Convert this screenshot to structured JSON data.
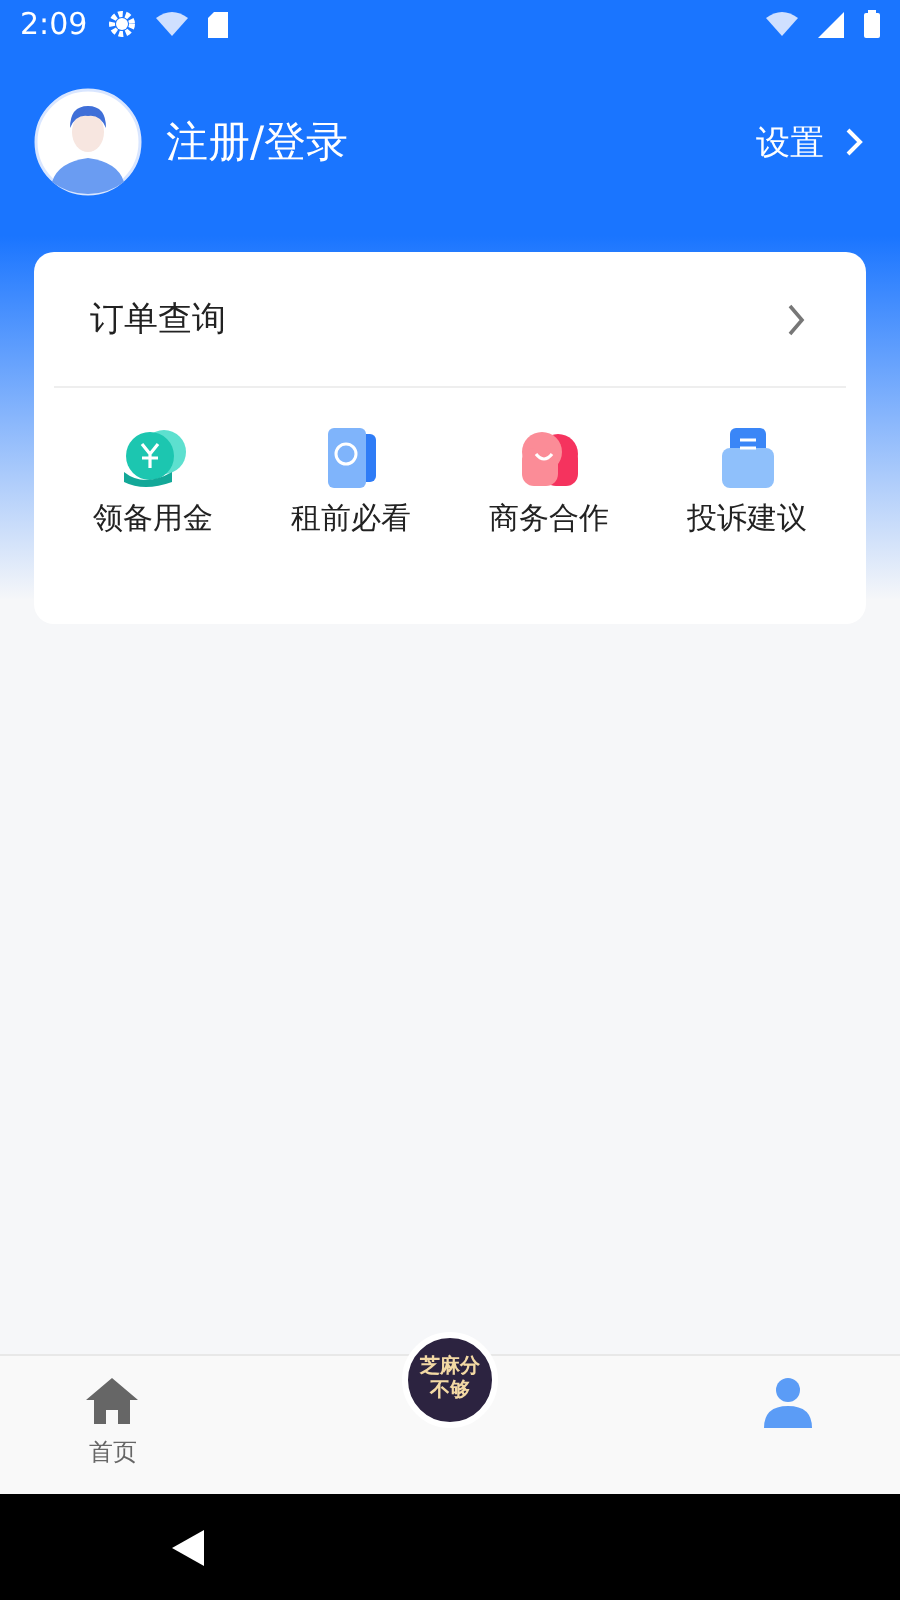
{
  "status_bar": {
    "time": "2:09"
  },
  "header": {
    "title": "注册/登录",
    "settings": "设置"
  },
  "card": {
    "order_link": "订单查询",
    "shortcuts": [
      {
        "label": "领备用金",
        "kind": "coin"
      },
      {
        "label": "租前必看",
        "kind": "phone"
      },
      {
        "label": "商务合作",
        "kind": "handshake"
      },
      {
        "label": "投诉建议",
        "kind": "document"
      }
    ]
  },
  "bottom_nav": [
    {
      "kind": "home",
      "label": "首页",
      "selected": false
    },
    {
      "kind": "badge",
      "lines": [
        "芝麻分",
        "不够"
      ]
    },
    {
      "kind": "user",
      "selected": true
    }
  ]
}
